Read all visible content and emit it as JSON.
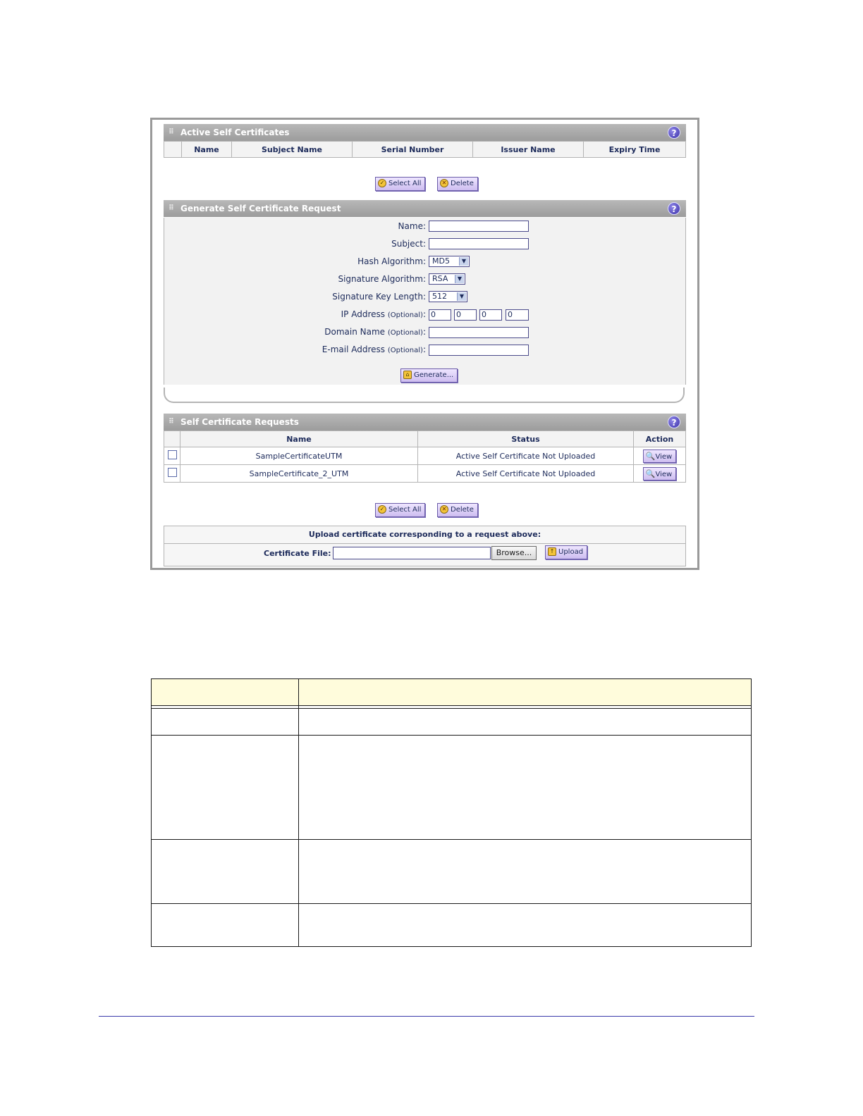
{
  "active": {
    "title": "Active Self Certificates",
    "help": "?",
    "columns": [
      "Name",
      "Subject Name",
      "Serial Number",
      "Issuer Name",
      "Expiry Time"
    ],
    "select_all": "Select All",
    "delete": "Delete"
  },
  "generate": {
    "title": "Generate Self Certificate Request",
    "help": "?",
    "name_label": "Name:",
    "subject_label": "Subject:",
    "hash_label": "Hash Algorithm:",
    "hash_value": "MD5",
    "sig_label": "Signature Algorithm:",
    "sig_value": "RSA",
    "keylen_label": "Signature Key Length:",
    "keylen_value": "512",
    "ip_label": "IP Address",
    "optional": "(Optional)",
    "ip_colon": ":",
    "ip_octets": [
      "0",
      "0",
      "0",
      "0"
    ],
    "domain_label": "Domain Name",
    "email_label": "E-mail Address",
    "generate_button": "Generate..."
  },
  "requests": {
    "title": "Self Certificate Requests",
    "help": "?",
    "columns": [
      "Name",
      "Status",
      "Action"
    ],
    "rows": [
      {
        "name": "SampleCertificateUTM",
        "status": "Active Self Certificate Not Uploaded",
        "action": "View"
      },
      {
        "name": "SampleCertificate_2_UTM",
        "status": "Active Self Certificate Not Uploaded",
        "action": "View"
      }
    ],
    "select_all": "Select All",
    "delete": "Delete"
  },
  "upload": {
    "heading": "Upload certificate corresponding to a request above:",
    "file_label": "Certificate File:",
    "browse": "Browse...",
    "upload": "Upload"
  },
  "colors": {
    "header_bg": "#a8a8a8",
    "button_bg": "#d8ccf4",
    "doc_header_bg": "#fffcdc",
    "rule": "#3a3aaa"
  }
}
